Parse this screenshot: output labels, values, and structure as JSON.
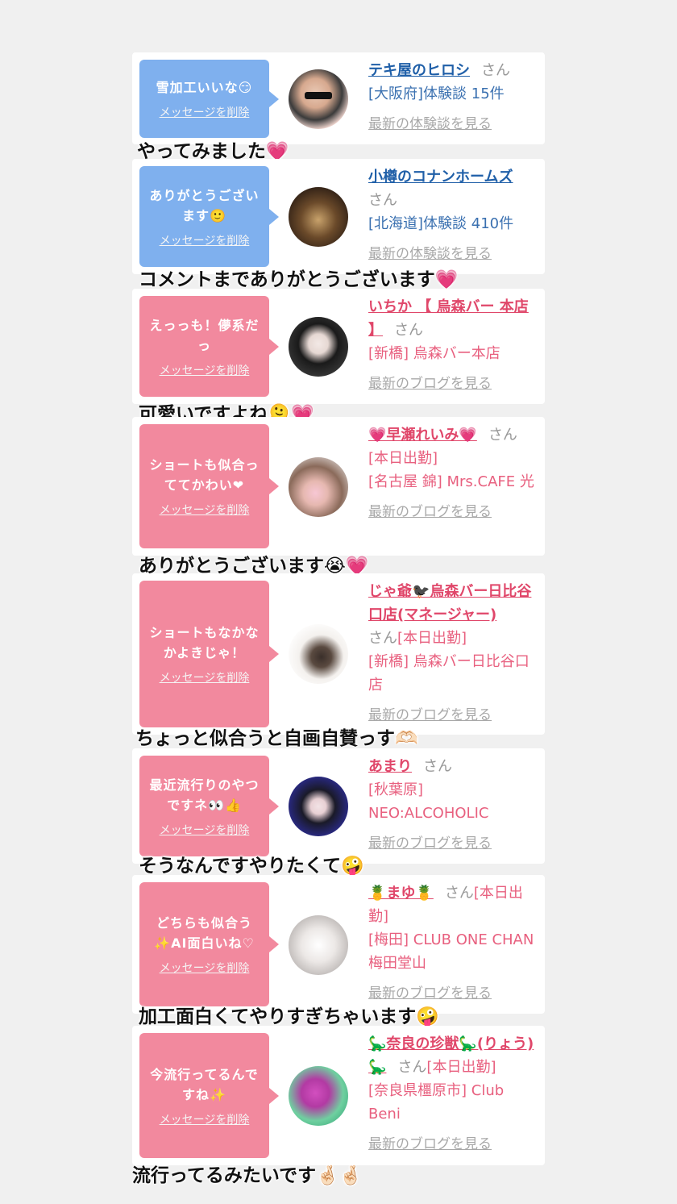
{
  "cards": [
    {
      "message": "雪加工いいな😏",
      "delete": "メッセージを削除",
      "name": "テキ屋のヒロシ",
      "san": "さん",
      "detail": [
        "[大阪府]体験談 15件"
      ],
      "more": "最新の体験談を見る",
      "caption": "やってみました💗"
    },
    {
      "message": "ありがとうございます🙂",
      "delete": "メッセージを削除",
      "name": "小樽のコナンホームズ",
      "san": "さん",
      "detail": [
        "[北海道]体験談 410件"
      ],
      "more": "最新の体験談を見る",
      "caption": "コメントまでありがとうございます💗"
    },
    {
      "message": "えっっも！儚系だっ",
      "delete": "メッセージを削除",
      "name": "いちか 【 烏森バー 本店 】",
      "san": "さん",
      "detail": [
        "[新橋] 烏森バー本店"
      ],
      "more": "最新のブログを見る",
      "caption": "可愛いですよね🫠💗"
    },
    {
      "message": "ショートも似合っててかわい❤",
      "delete": "メッセージを削除",
      "name": "💗早瀬れいみ💗",
      "san": "さん",
      "detail": [
        "[本日出勤]",
        "[名古屋 錦] Mrs.CAFE 光"
      ],
      "more": "最新のブログを見る",
      "caption": "ありがとうございます😭💗"
    },
    {
      "message": "ショートもなかなかよきじゃ！",
      "delete": "メッセージを削除",
      "name": "じゃ爺🐦‍⬛烏森バー日比谷口店(マネージャー)",
      "san": "さん",
      "detail": [
        "[本日出勤]",
        "[新橋] 烏森バー日比谷口店"
      ],
      "more": "最新のブログを見る",
      "caption": "ちょっと似合うと自画自賛っす🫶🏻"
    },
    {
      "message": "最近流行りのやつですネ👀👍",
      "delete": "メッセージを削除",
      "name": "あまり",
      "san": "さん",
      "detail": [
        "[秋葉原] NEO:ALCOHOLIC"
      ],
      "more": "最新のブログを見る",
      "caption": "そうなんですやりたくて🤪"
    },
    {
      "message": "どちらも似合う✨AI面白いね♡",
      "delete": "メッセージを削除",
      "name": "🍍まゆ🍍",
      "san": "さん",
      "detail": [
        "[本日出勤]",
        "[梅田] CLUB ONE CHAN 梅田堂山"
      ],
      "more": "最新のブログを見る",
      "caption": "加工面白くてやりすぎちゃいます🤪"
    },
    {
      "message": "今流行ってるんですね✨",
      "delete": "メッセージを削除",
      "name": "🦕奈良の珍獣🦕(りょう)🦕",
      "san": "さん",
      "detail": [
        "[本日出勤]",
        "[奈良県橿原市] Club Beni"
      ],
      "more": "最新のブログを見る",
      "caption": "流行ってるみたいです🤞🏻🤞🏻"
    }
  ],
  "colors": {
    "blue": "#7fb0ee",
    "pink": "#f2899e",
    "background": "#f0f0f0"
  }
}
